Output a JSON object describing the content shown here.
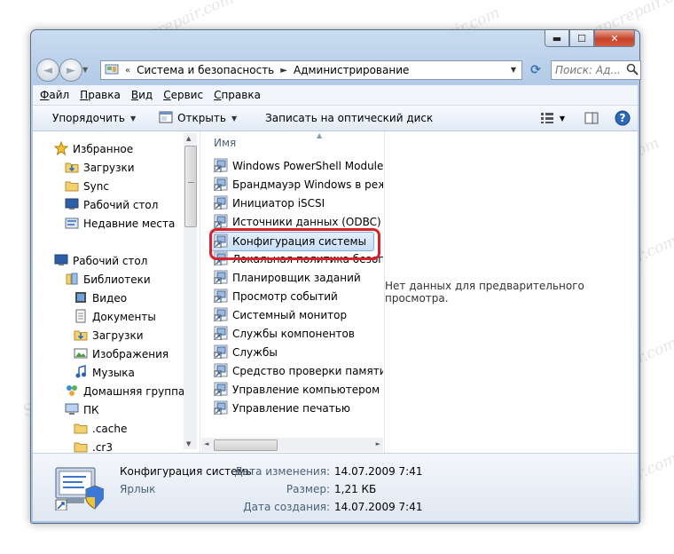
{
  "watermark": "Soringpcrepair.com",
  "window": {
    "controls": {
      "minimize": "▬",
      "maximize": "☐",
      "close": "✕"
    }
  },
  "nav": {
    "back": "◄",
    "forward": "►",
    "breadcrumb": [
      "Система и безопасность",
      "Администрирование"
    ],
    "search_placeholder": "Поиск: Ад..."
  },
  "menu": [
    {
      "label": "Файл",
      "key": "Ф"
    },
    {
      "label": "Правка",
      "key": "П"
    },
    {
      "label": "Вид",
      "key": "В"
    },
    {
      "label": "Сервис",
      "key": "С"
    },
    {
      "label": "Справка",
      "key": "С"
    }
  ],
  "toolbar": {
    "organize": "Упорядочить",
    "open": "Открыть",
    "burn": "Записать на оптический диск"
  },
  "navpane": [
    {
      "label": "Избранное",
      "icon": "star-icon",
      "indent": 0
    },
    {
      "label": "Загрузки",
      "icon": "downloads-folder-icon",
      "indent": 1
    },
    {
      "label": "Sync",
      "icon": "folder-icon",
      "indent": 1
    },
    {
      "label": "Рабочий стол",
      "icon": "desktop-icon",
      "indent": 1
    },
    {
      "label": "Недавние места",
      "icon": "recent-places-icon",
      "indent": 1
    },
    {
      "label": "Рабочий стол",
      "icon": "desktop-icon",
      "indent": 0
    },
    {
      "label": "Библиотеки",
      "icon": "libraries-icon",
      "indent": 1
    },
    {
      "label": "Видео",
      "icon": "video-icon",
      "indent": 2
    },
    {
      "label": "Документы",
      "icon": "documents-icon",
      "indent": 2
    },
    {
      "label": "Загрузки",
      "icon": "downloads-folder-icon",
      "indent": 2
    },
    {
      "label": "Изображения",
      "icon": "pictures-icon",
      "indent": 2
    },
    {
      "label": "Музыка",
      "icon": "music-icon",
      "indent": 2
    },
    {
      "label": "Домашняя группа",
      "icon": "homegroup-icon",
      "indent": 1
    },
    {
      "label": "ПК",
      "icon": "computer-icon",
      "indent": 1
    },
    {
      "label": ".cache",
      "icon": "folder-icon",
      "indent": 2
    },
    {
      "label": ".cr3",
      "icon": "folder-icon",
      "indent": 2
    }
  ],
  "files": {
    "column": "Имя",
    "items": [
      "Windows PowerShell Modules",
      "Брандмауэр Windows в режим",
      "Инициатор iSCSI",
      "Источники данных (ODBC)",
      "Конфигурация системы",
      "Локальная политика безопаст",
      "Планировщик заданий",
      "Просмотр событий",
      "Системный монитор",
      "Службы компонентов",
      "Службы",
      "Средство проверки памяти W",
      "Управление компьютером",
      "Управление печатью"
    ],
    "selected_index": 4
  },
  "preview_text": "Нет данных для предварительного просмотра.",
  "details": {
    "name": "Конфигурация системы",
    "type": "Ярлык",
    "modified_label": "Дата изменения:",
    "modified": "14.07.2009 7:41",
    "size_label": "Размер:",
    "size": "1,21 КБ",
    "created_label": "Дата создания:",
    "created": "14.07.2009 7:41"
  },
  "colors": {
    "highlight_border": "#d6222a",
    "selection": "#c9dff8",
    "chrome": "#b3cbe6"
  }
}
